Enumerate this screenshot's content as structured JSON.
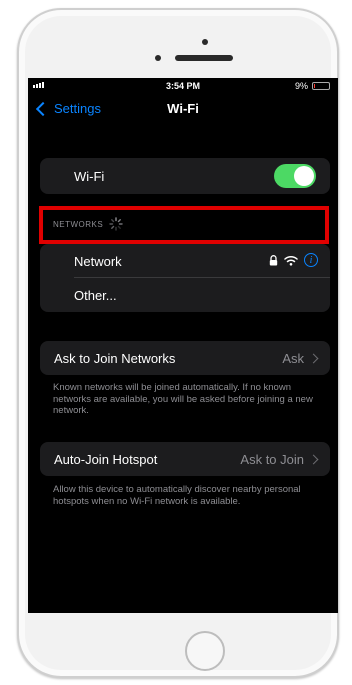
{
  "status_bar": {
    "time": "3:54 PM",
    "battery": "9%",
    "battery_level": 0.09
  },
  "nav": {
    "back_label": "Settings",
    "title": "Wi-Fi"
  },
  "wifi_toggle": {
    "label": "Wi-Fi",
    "on": true
  },
  "networks": {
    "header": "NETWORKS",
    "items": [
      {
        "name": "Network",
        "locked": true
      }
    ],
    "other_label": "Other..."
  },
  "ask_to_join": {
    "label": "Ask to Join Networks",
    "value": "Ask",
    "footnote": "Known networks will be joined automatically. If no known networks are available, you will be asked before joining a new network."
  },
  "auto_join": {
    "label": "Auto-Join Hotspot",
    "value": "Ask to Join",
    "footnote": "Allow this device to automatically discover nearby personal hotspots when no Wi-Fi network is available."
  },
  "colors": {
    "accent": "#0a84ff",
    "toggle_on": "#4cd964",
    "highlight": "#e00000"
  }
}
